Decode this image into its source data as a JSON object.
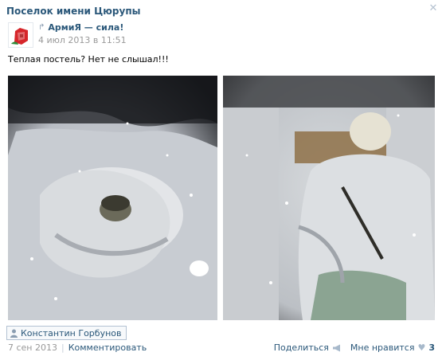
{
  "post": {
    "group_name": "Поселок имени Цюрупы",
    "repost_from": "АрмиЯ — сила!",
    "date": "4 июл 2013 в 11:51",
    "text": "Теплая постель? Нет не слышал!!!"
  },
  "tag": {
    "person": "Константин Горбунов"
  },
  "footer": {
    "date": "7 сен 2013",
    "separator": "|",
    "comment_label": "Комментировать",
    "share_label": "Поделиться",
    "like_label": "Мне нравится",
    "like_count": "3"
  },
  "icons": [
    "close-icon",
    "repost-arrow-icon",
    "person-icon",
    "megaphone-icon",
    "heart-icon"
  ],
  "colors": {
    "link": "#2b587a",
    "muted": "#999999",
    "icon": "#a7b9cb"
  }
}
